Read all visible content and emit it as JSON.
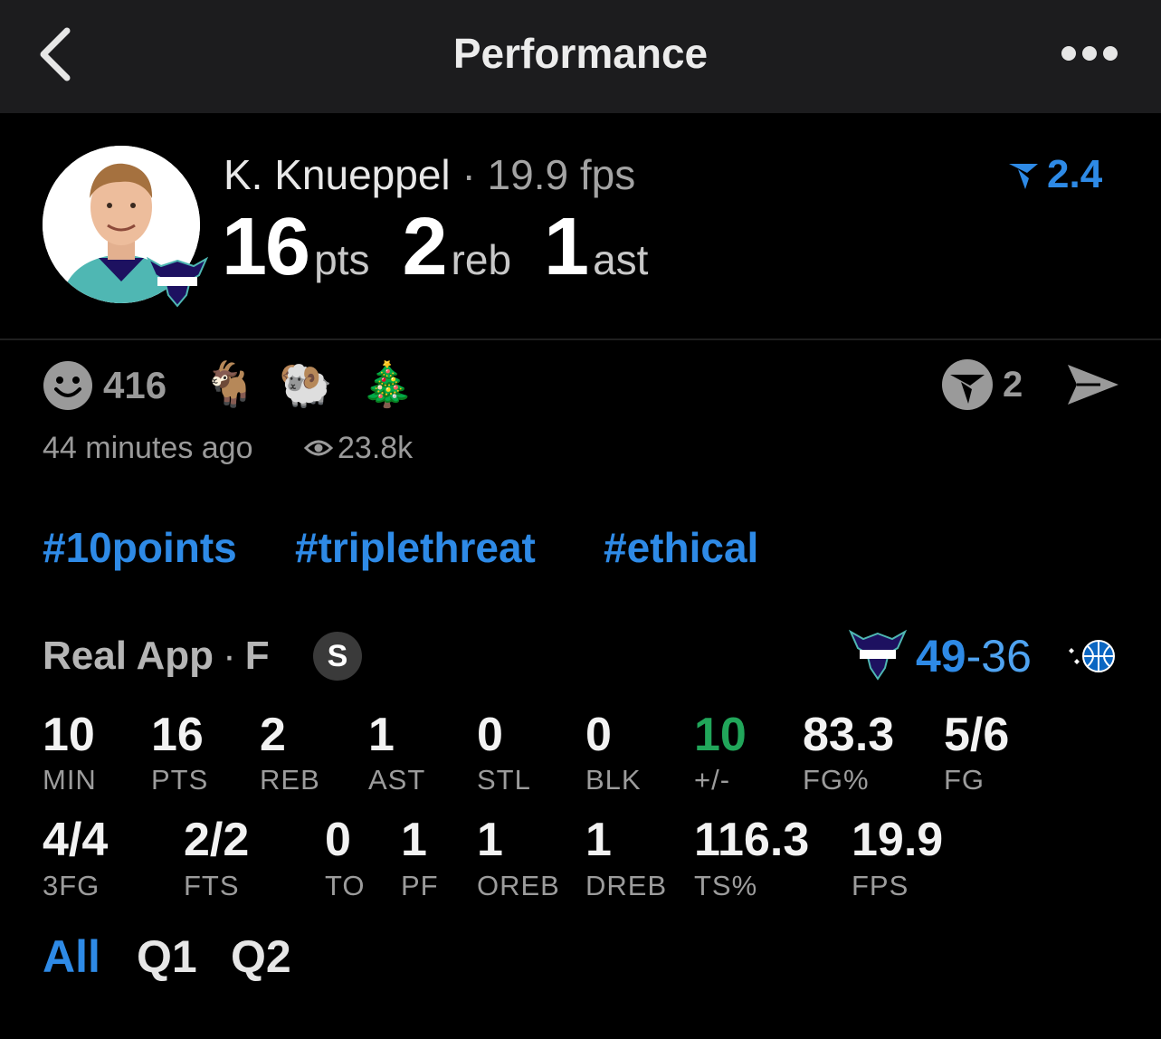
{
  "header": {
    "title": "Performance"
  },
  "player": {
    "name": "K. Knueppel",
    "dot": "·",
    "fps": "19.9 fps",
    "rank": "2.4",
    "stats": [
      {
        "value": "16",
        "unit": "pts"
      },
      {
        "value": "2",
        "unit": "reb"
      },
      {
        "value": "1",
        "unit": "ast"
      }
    ]
  },
  "reactions": {
    "count": "416",
    "emojis": [
      "🐐",
      "🐏",
      "🎄"
    ],
    "vote_count": "2",
    "time": "44 minutes ago",
    "views": "23.8k"
  },
  "hashtags": [
    "#10points",
    "#triplethreat",
    "#ethical"
  ],
  "game": {
    "source": "Real App",
    "dot": "·",
    "position": "F",
    "badge": "S",
    "team_score": "49",
    "dash": "-",
    "opp_score": "36"
  },
  "box_row1": [
    {
      "value": "10",
      "label": "MIN"
    },
    {
      "value": "16",
      "label": "PTS"
    },
    {
      "value": "2",
      "label": "REB"
    },
    {
      "value": "1",
      "label": "AST"
    },
    {
      "value": "0",
      "label": "STL"
    },
    {
      "value": "0",
      "label": "BLK"
    },
    {
      "value": "10",
      "label": "+/-"
    },
    {
      "value": "83.3",
      "label": "FG%"
    },
    {
      "value": "5/6",
      "label": "FG"
    }
  ],
  "box_row2": [
    {
      "value": "4/4",
      "label": "3FG"
    },
    {
      "value": "2/2",
      "label": "FTS"
    },
    {
      "value": "0",
      "label": "TO"
    },
    {
      "value": "1",
      "label": "PF"
    },
    {
      "value": "1",
      "label": "OREB"
    },
    {
      "value": "1",
      "label": "DREB"
    },
    {
      "value": "116.3",
      "label": "TS%"
    },
    {
      "value": "19.9",
      "label": "FPS"
    }
  ],
  "tabs": [
    "All",
    "Q1",
    "Q2"
  ],
  "colors": {
    "accent": "#2e8ae6",
    "positive": "#21a65a",
    "muted": "#9a9a9a"
  }
}
